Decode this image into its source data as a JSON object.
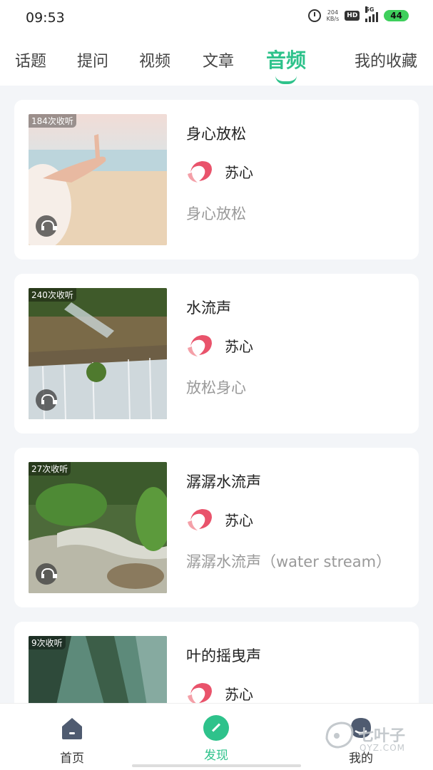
{
  "status_bar": {
    "time": "09:53",
    "net_speed_value": "204",
    "net_speed_unit": "KB/s",
    "hd": "HD",
    "network": "5G",
    "battery": "44"
  },
  "tabs": [
    {
      "label": "话题",
      "active": false
    },
    {
      "label": "提问",
      "active": false
    },
    {
      "label": "视频",
      "active": false
    },
    {
      "label": "文章",
      "active": false
    },
    {
      "label": "音频",
      "active": true
    },
    {
      "label": "我的收藏",
      "active": false
    }
  ],
  "cards": [
    {
      "listens": "184次收听",
      "title": "身心放松",
      "author": "苏心",
      "description": "身心放松"
    },
    {
      "listens": "240次收听",
      "title": "水流声",
      "author": "苏心",
      "description": "放松身心"
    },
    {
      "listens": "27次收听",
      "title": "潺潺水流声",
      "author": "苏心",
      "description": "潺潺水流声（water stream）"
    },
    {
      "listens": "9次收听",
      "title": "叶的摇曳声",
      "author": "苏心",
      "description": ""
    }
  ],
  "bottom_nav": [
    {
      "label": "首页",
      "icon": "home-icon",
      "active": false
    },
    {
      "label": "发现",
      "icon": "compass-icon",
      "active": true
    },
    {
      "label": "我的",
      "icon": "profile-icon",
      "active": false
    }
  ],
  "watermark": {
    "text": "七叶子",
    "sub": "QYZ.COM"
  },
  "colors": {
    "accent": "#2ec28b",
    "background": "#f3f5f8",
    "muted_text": "#999999"
  }
}
